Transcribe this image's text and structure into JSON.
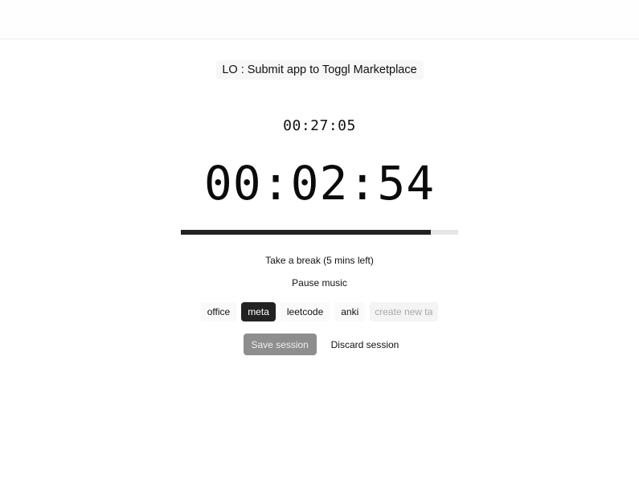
{
  "task": {
    "title": "LO : Submit app to Toggl Marketplace"
  },
  "timer": {
    "total_elapsed": "00:27:05",
    "session_elapsed": "00:02:54",
    "progress_fraction": 0.9
  },
  "controls": {
    "break_label": "Take a break (5 mins left)",
    "music_label": "Pause music"
  },
  "tags": {
    "items": [
      {
        "label": "office",
        "active": false
      },
      {
        "label": "meta",
        "active": true
      },
      {
        "label": "leetcode",
        "active": false
      },
      {
        "label": "anki",
        "active": false
      }
    ],
    "new_tag_placeholder": "create new tag"
  },
  "actions": {
    "save_label": "Save session",
    "discard_label": "Discard session"
  },
  "colors": {
    "accent": "#232323",
    "track": "#e6e6e6",
    "save_disabled": "#8e8e8e"
  }
}
